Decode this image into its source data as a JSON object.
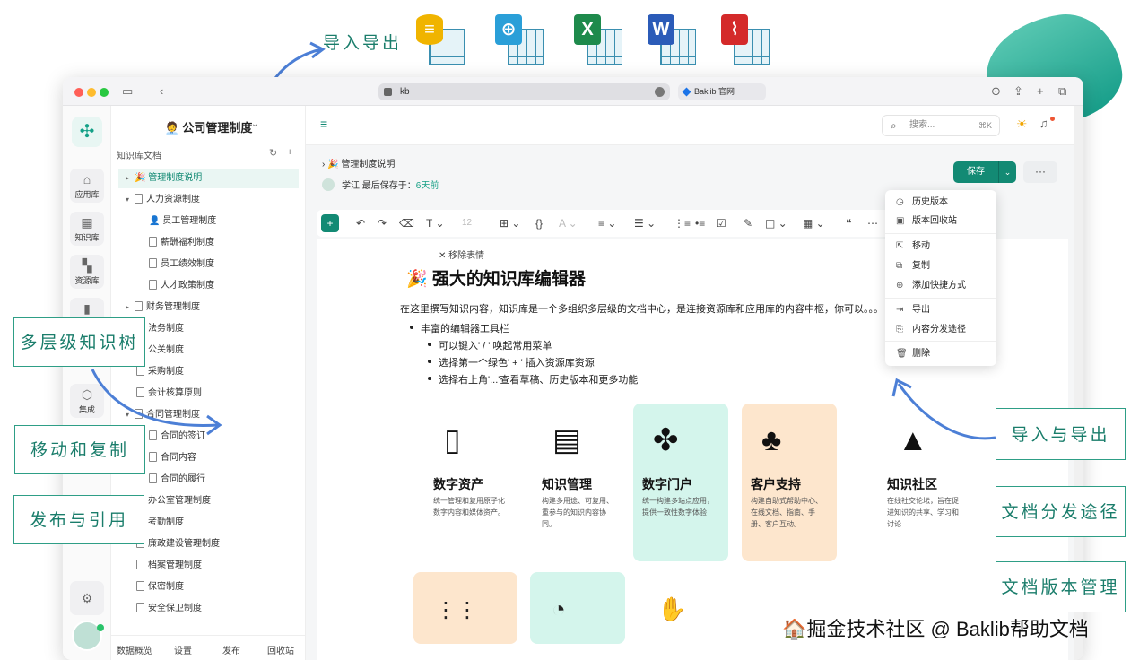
{
  "annotations": {
    "import_export_top": "导入导出",
    "tree": "多层级知识树",
    "move_copy": "移动和复制",
    "publish": "发布与引用",
    "import_export": "导入与导出",
    "distribution": "文档分发途径",
    "versions": "文档版本管理"
  },
  "browser": {
    "url": "kb",
    "tab2": "Baklib 官网"
  },
  "rail": {
    "items": [
      "应用库",
      "知识库",
      "资源库",
      "",
      "集成"
    ]
  },
  "tree": {
    "title": "🧑‍💼 公司管理制度",
    "subtitle": "知识库文档",
    "nodes": [
      "🎉 管理制度说明",
      "人力资源制度",
      "👤 员工管理制度",
      "薪酬福利制度",
      "员工绩效制度",
      "人才政策制度",
      "财务管理制度",
      "法务制度",
      "公关制度",
      "采购制度",
      "会计核算原则",
      "合同管理制度",
      "合同的签订",
      "合同内容",
      "合同的履行",
      "办公室管理制度",
      "考勤制度",
      "廉政建设管理制度",
      "档案管理制度",
      "保密制度",
      "安全保卫制度"
    ],
    "footer": [
      "数据概览",
      "设置",
      "发布",
      "回收站"
    ]
  },
  "editor": {
    "search_placeholder": "搜索...",
    "search_kbd": "⌘K",
    "crumb": "🎉 管理制度说明",
    "author": "学江",
    "last_saved": "最后保存于：",
    "saved_ago": "6天前",
    "save": "保存",
    "font_size": "12",
    "remove_emoji": "移除表情",
    "title": "🎉 强大的知识库编辑器",
    "intro": "在这里撰写知识内容，知识库是一个多组织多层级的文档中心，是连接资源库和应用库的内容中枢，你可以。。。",
    "bullet": "丰富的编辑器工具栏",
    "subbullets": [
      "可以键入' / ' 唤起常用菜单",
      "选择第一个绿色' + ' 插入资源库资源",
      "选择右上角'...'查看草稿、历史版本和更多功能"
    ],
    "cards": [
      {
        "title": "数字资产",
        "desc": "统一管理和复用原子化数字内容和媒体资产。"
      },
      {
        "title": "知识管理",
        "desc": "构建多用途、可复用、重参与的知识内容协同。"
      },
      {
        "title": "数字门户",
        "desc": "统一构建多站点应用，提供一致性数字体验"
      },
      {
        "title": "客户支持",
        "desc": "构建自助式帮助中心、在线文档、指南、手册、客户互动。"
      },
      {
        "title": "知识社区",
        "desc": "在线社交论坛，旨在促进知识的共享、学习和讨论"
      }
    ]
  },
  "menu": [
    "历史版本",
    "版本回收站",
    "移动",
    "复制",
    "添加快捷方式",
    "导出",
    "内容分发途径",
    "删除"
  ],
  "watermark": "🏠掘金技术社区 @ Baklib帮助文档",
  "colors": {
    "accent": "#138a74",
    "annotation": "#1a7d6b"
  }
}
